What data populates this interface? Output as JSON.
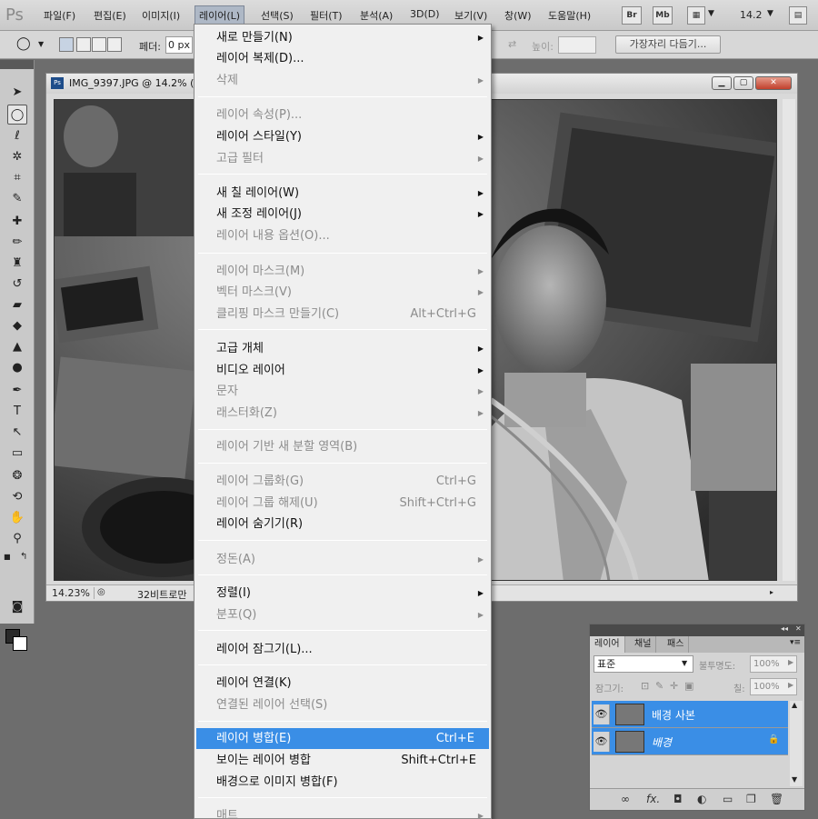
{
  "app": {
    "logo": "Ps"
  },
  "menubar": {
    "items": [
      "파일(F)",
      "편집(E)",
      "이미지(I)",
      "레이어(L)",
      "선택(S)",
      "필터(T)",
      "분석(A)",
      "3D(D)",
      "보기(V)",
      "창(W)",
      "도움말(H)"
    ],
    "br": "Br",
    "mb": "Mb",
    "zoom": "14.2"
  },
  "options": {
    "feather_label": "페더:",
    "feather_value": "0 px",
    "height_label": "높이:",
    "refine_label": "가장자리 다듬기..."
  },
  "document": {
    "title": "IMG_9397.JPG @ 14.2% (",
    "zoom": "14.23%",
    "info": "32비트로만"
  },
  "menu": {
    "new": "새로 만들기(N)",
    "duplicate": "레이어 복제(D)...",
    "delete": "삭제",
    "properties": "레이어 속성(P)...",
    "style": "레이어 스타일(Y)",
    "smart_filter": "고급 필터",
    "new_fill": "새 칠 레이어(W)",
    "new_adjust": "새 조정 레이어(J)",
    "content_options": "레이어 내용 옵션(O)...",
    "layer_mask": "레이어 마스크(M)",
    "vector_mask": "벡터 마스크(V)",
    "clipping_mask": "클리핑 마스크 만들기(C)",
    "clipping_mask_sc": "Alt+Ctrl+G",
    "smart_objects": "고급 개체",
    "video_layers": "비디오 레이어",
    "type": "문자",
    "rasterize": "래스터화(Z)",
    "slice": "레이어 기반 새 분할 영역(B)",
    "group": "레이어 그룹화(G)",
    "group_sc": "Ctrl+G",
    "ungroup": "레이어 그룹 해제(U)",
    "ungroup_sc": "Shift+Ctrl+G",
    "hide": "레이어 숨기기(R)",
    "arrange": "정돈(A)",
    "align": "정렬(I)",
    "distribute": "분포(Q)",
    "lock": "레이어 잠그기(L)...",
    "link": "레이어 연결(K)",
    "select_linked": "연결된 레이어 선택(S)",
    "merge": "레이어 병합(E)",
    "merge_sc": "Ctrl+E",
    "merge_visible": "보이는 레이어 병합",
    "merge_visible_sc": "Shift+Ctrl+E",
    "flatten": "배경으로 이미지 병합(F)",
    "matting": "매트"
  },
  "layers_panel": {
    "tabs": [
      "레이어",
      "채널",
      "패스"
    ],
    "blend_mode": "표준",
    "opacity_label": "불투명도:",
    "opacity": "100%",
    "lock_label": "잠그기:",
    "fill_label": "칠:",
    "fill": "100%",
    "layers": [
      {
        "name": "배경 사본",
        "italic": false,
        "locked": false
      },
      {
        "name": "배경",
        "italic": true,
        "locked": true
      }
    ]
  }
}
